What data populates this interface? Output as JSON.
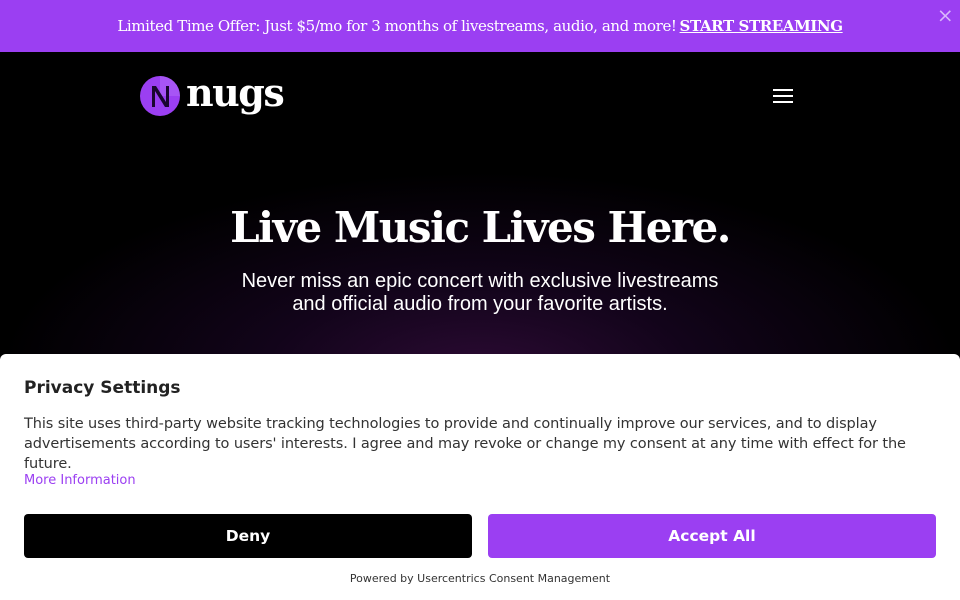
{
  "promo": {
    "text": "Limited Time Offer: Just $5/mo for 3 months of livestreams, audio, and more!",
    "cta": "START STREAMING",
    "close_glyph": "×"
  },
  "header": {
    "logo_text": "nugs",
    "menu_icon": "hamburger-menu-icon"
  },
  "hero": {
    "title": "Live Music Lives Here.",
    "subtitle_line1": "Never miss an epic concert with exclusive livestreams",
    "subtitle_line2": "and official audio from your favorite artists."
  },
  "consent": {
    "title": "Privacy Settings",
    "body": "This site uses third-party website tracking technologies to provide and continually improve our services, and to display advertisements according to users' interests. I agree and may revoke or change my consent at any time with effect for the future.",
    "more_info": "More Information",
    "deny_label": "Deny",
    "accept_label": "Accept All",
    "powered_by": "Powered by Usercentrics Consent Management"
  },
  "colors": {
    "brand_purple": "#9b3ff2",
    "background": "#000000"
  }
}
